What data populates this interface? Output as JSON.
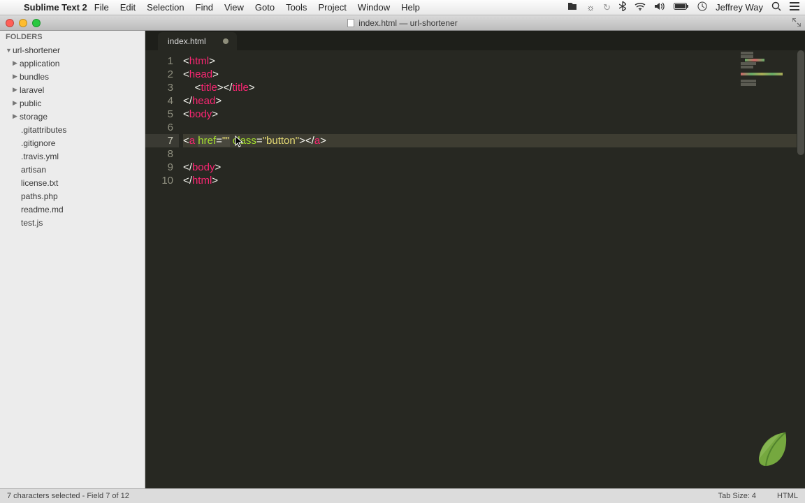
{
  "menubar": {
    "app": "Sublime Text 2",
    "items": [
      "File",
      "Edit",
      "Selection",
      "Find",
      "View",
      "Goto",
      "Tools",
      "Project",
      "Window",
      "Help"
    ],
    "user": "Jeffrey Way"
  },
  "window": {
    "title": "index.html — url-shortener"
  },
  "sidebar": {
    "header": "FOLDERS",
    "root": "url-shortener",
    "folders": [
      "application",
      "bundles",
      "laravel",
      "public",
      "storage"
    ],
    "files": [
      ".gitattributes",
      ".gitignore",
      ".travis.yml",
      "artisan",
      "license.txt",
      "paths.php",
      "readme.md",
      "test.js"
    ]
  },
  "tab": {
    "name": "index.html"
  },
  "gutter": {
    "lines": [
      "1",
      "2",
      "3",
      "4",
      "5",
      "6",
      "7",
      "8",
      "9",
      "10"
    ]
  },
  "statusbar": {
    "left": "7 characters selected - Field 7 of 12",
    "tabsize": "Tab Size: 4",
    "lang": "HTML"
  },
  "code": {
    "l1": {
      "a": "<",
      "b": "html",
      "c": ">"
    },
    "l2": {
      "a": "<",
      "b": "head",
      "c": ">"
    },
    "l3": {
      "a": "    <",
      "b": "title",
      "c": "></",
      "d": "title",
      "e": ">"
    },
    "l4": {
      "a": "</",
      "b": "head",
      "c": ">"
    },
    "l5": {
      "a": "<",
      "b": "body",
      "c": ">"
    },
    "l7": {
      "a": "<",
      "b": "a",
      "sp": " ",
      "c": "href",
      "eq": "=",
      "q": "\"\"",
      "sp2": " ",
      "d": "class",
      "eq2": "=",
      "q2": "\"",
      "e": "button",
      "q3": "\"",
      "f": "></",
      "g": "a",
      "h": ">"
    },
    "l9": {
      "a": "</",
      "b": "body",
      "c": ">"
    },
    "l10": {
      "a": "</",
      "b": "html",
      "c": ">"
    }
  }
}
